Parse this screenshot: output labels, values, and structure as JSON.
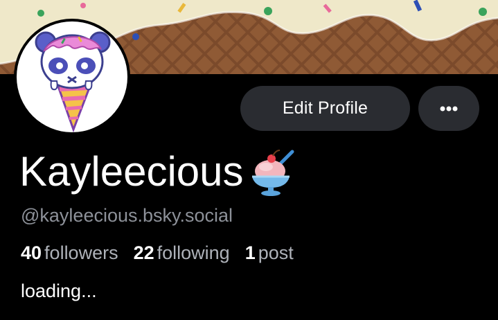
{
  "profile": {
    "display_name": "Kayleecious",
    "handle": "@kayleecious.bsky.social",
    "bio": "loading...",
    "name_emoji_icon": "shaved-ice-sundae-icon",
    "avatar_icon": "panda-ice-cream-cone-icon"
  },
  "actions": {
    "edit_label": "Edit Profile",
    "more_icon": "ellipsis-icon"
  },
  "stats": {
    "followers_count": "40",
    "followers_label": "followers",
    "following_count": "22",
    "following_label": "following",
    "posts_count": "1",
    "posts_label": "post"
  },
  "colors": {
    "background": "#000000",
    "button_bg": "#2a2c31",
    "handle_text": "#8d9199",
    "stat_label_text": "#aeb2b9",
    "banner_cream": "#efe8c9",
    "banner_waffle": "#7a4a2a"
  }
}
